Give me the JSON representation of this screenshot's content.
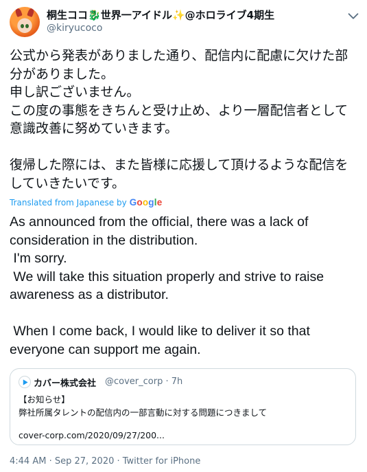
{
  "author": {
    "display_name_prefix": "桐生ココ",
    "display_name_emoji1": "🐉",
    "display_name_middle": "世界一アイドル",
    "display_name_emoji2": "✨",
    "display_name_suffix": "@ホロライブ4期生",
    "handle": "@kiryucoco",
    "avatar_icon": "avatar-icon"
  },
  "tweet": {
    "text": "公式から発表がありました通り、配信内に配慮に欠けた部分がありました。\n申し訳ございません。\nこの度の事態をきちんと受け止め、より一層配信者として意識改善に努めていきます。\n\n復帰した際には、また皆様に応援して頂けるような配信をしていきたいです。",
    "translated_label": "Translated from Japanese by",
    "google_letters": [
      "G",
      "o",
      "o",
      "g",
      "l",
      "e"
    ],
    "translation": "As announced from the official, there was a lack of consideration in the distribution.\n I'm sorry.\n We will take this situation properly and strive to raise awareness as a distributor.\n\n When I come back, I would like to deliver it so that everyone can support me again."
  },
  "quoted_tweet": {
    "name": "カバー株式会社",
    "handle_time": "@cover_corp · 7h",
    "line1": "【お知らせ】",
    "line2": "弊社所属タレントの配信内の一部言動に対する問題につきまして",
    "link": "cover-corp.com/2020/09/27/200..."
  },
  "meta": {
    "timestamp": "4:44 AM · Sep 27, 2020 · Twitter for iPhone"
  },
  "colors": {
    "link": "#1d9bf0",
    "secondary_text": "#5b7083",
    "border": "#cfd9de"
  }
}
